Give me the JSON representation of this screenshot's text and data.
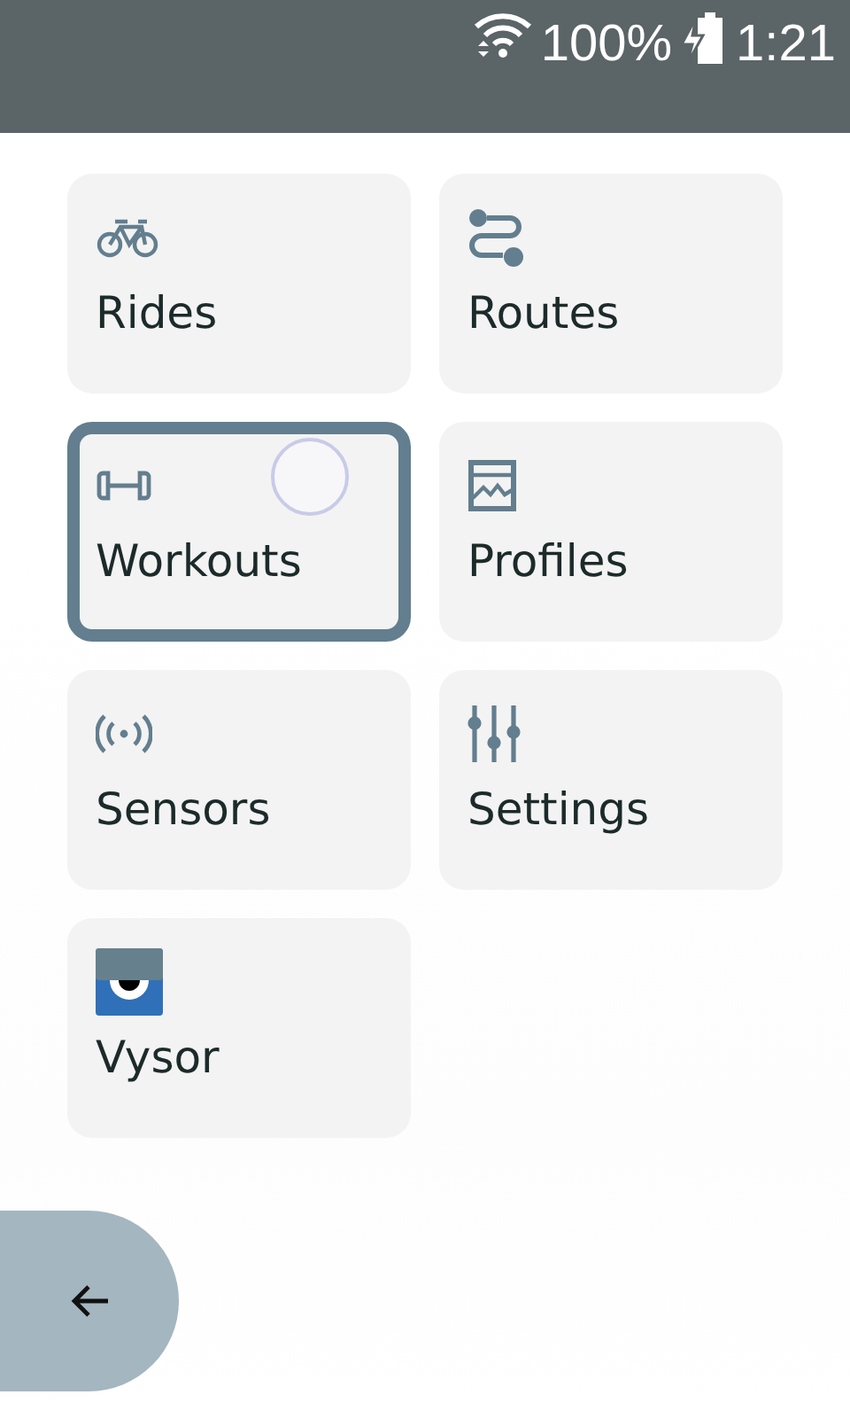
{
  "status_bar": {
    "battery": "100%",
    "time": "1:21"
  },
  "tiles": [
    {
      "label": "Rides",
      "kind": "bike",
      "selected": false,
      "touched": false
    },
    {
      "label": "Routes",
      "kind": "route",
      "selected": false,
      "touched": false
    },
    {
      "label": "Workouts",
      "kind": "dumbbell",
      "selected": true,
      "touched": true
    },
    {
      "label": "Profiles",
      "kind": "chart",
      "selected": false,
      "touched": false
    },
    {
      "label": "Sensors",
      "kind": "signal",
      "selected": false,
      "touched": false
    },
    {
      "label": "Settings",
      "kind": "sliders",
      "selected": false,
      "touched": false
    },
    {
      "label": "Vysor",
      "kind": "app",
      "selected": false,
      "touched": false
    }
  ]
}
